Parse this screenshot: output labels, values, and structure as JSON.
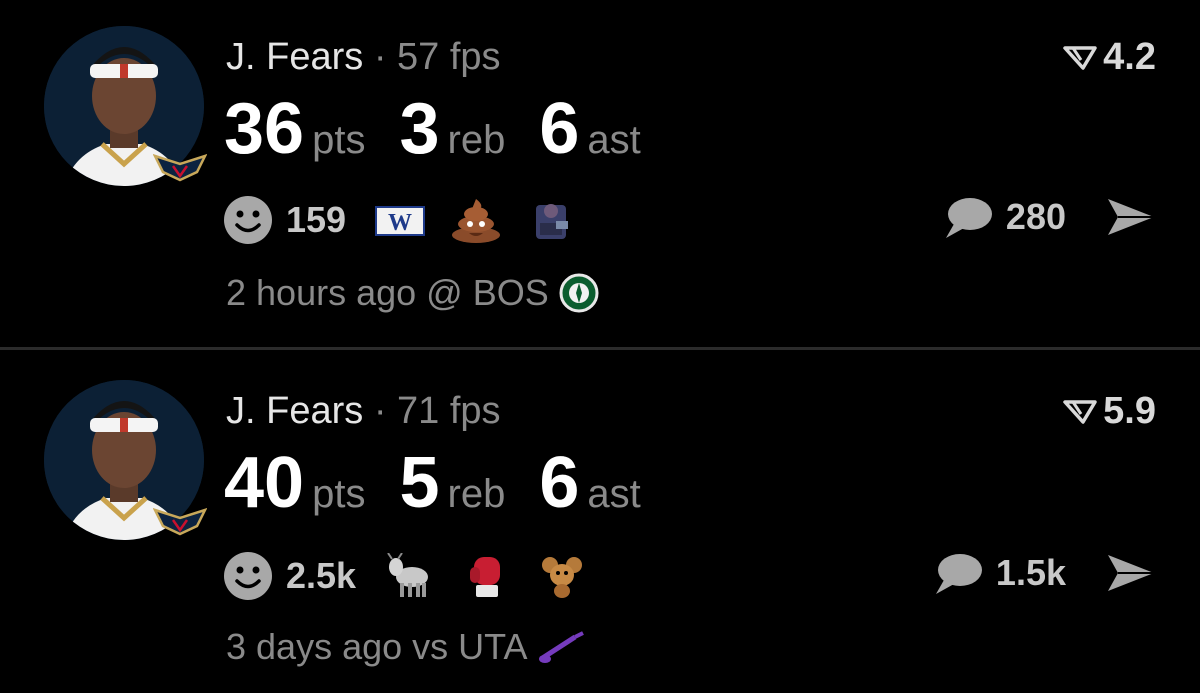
{
  "feed": [
    {
      "player": "J. Fears",
      "separator": "·",
      "fps": "57 fps",
      "score": "4.2",
      "stats": [
        {
          "value": "36",
          "unit": "pts"
        },
        {
          "value": "3",
          "unit": "reb"
        },
        {
          "value": "6",
          "unit": "ast"
        }
      ],
      "reaction_count": "159",
      "reaction_emojis": [
        "w-flag-icon",
        "poop-emoji",
        "figure-emoji"
      ],
      "comment_count": "280",
      "time": "2 hours ago",
      "venue": "@ BOS",
      "opponent_logo": "celtics-logo-icon"
    },
    {
      "player": "J. Fears",
      "separator": "·",
      "fps": "71 fps",
      "score": "5.9",
      "stats": [
        {
          "value": "40",
          "unit": "pts"
        },
        {
          "value": "5",
          "unit": "reb"
        },
        {
          "value": "6",
          "unit": "ast"
        }
      ],
      "reaction_count": "2.5k",
      "reaction_emojis": [
        "goat-emoji",
        "boxing-glove-emoji",
        "cartoon-mouse-emoji"
      ],
      "comment_count": "1.5k",
      "time": "3 days ago",
      "venue": "vs UTA",
      "opponent_logo": "jazz-logo-icon"
    }
  ],
  "colors": {
    "background": "#000000",
    "muted": "#8a8a8a",
    "primary": "#ffffff",
    "divider": "#2b2b2b"
  }
}
